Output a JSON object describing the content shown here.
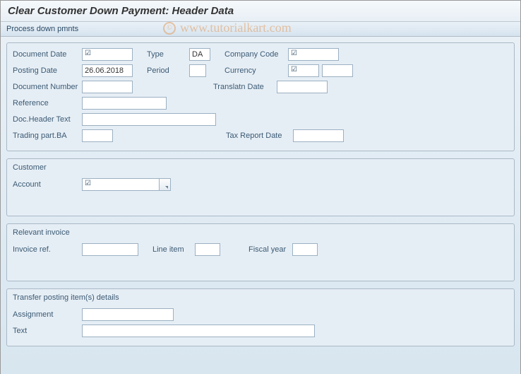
{
  "header": {
    "title": "Clear Customer Down Payment: Header Data"
  },
  "toolbar": {
    "process": "Process down pmnts"
  },
  "fields": {
    "document_date_label": "Document Date",
    "document_date_value": "",
    "posting_date_label": "Posting Date",
    "posting_date_value": "26.06.2018",
    "document_number_label": "Document Number",
    "document_number_value": "",
    "reference_label": "Reference",
    "reference_value": "",
    "doc_header_text_label": "Doc.Header Text",
    "doc_header_text_value": "",
    "trading_part_ba_label": "Trading part.BA",
    "trading_part_ba_value": "",
    "type_label": "Type",
    "type_value": "DA",
    "period_label": "Period",
    "period_value": "",
    "company_code_label": "Company Code",
    "company_code_value": "",
    "currency_label": "Currency",
    "currency_value": "",
    "translatn_date_label": "Translatn Date",
    "translatn_date_value": "",
    "tax_report_date_label": "Tax Report Date",
    "tax_report_date_value": ""
  },
  "customer": {
    "title": "Customer",
    "account_label": "Account",
    "account_value": ""
  },
  "invoice": {
    "title": "Relevant invoice",
    "invoice_ref_label": "Invoice ref.",
    "invoice_ref_value": "",
    "line_item_label": "Line item",
    "line_item_value": "",
    "fiscal_year_label": "Fiscal year",
    "fiscal_year_value": ""
  },
  "transfer": {
    "title": "Transfer posting item(s) details",
    "assignment_label": "Assignment",
    "assignment_value": "",
    "text_label": "Text",
    "text_value": ""
  },
  "watermark": {
    "copy": "©",
    "text": "www.tutorialkart.com"
  },
  "req_marker": "☑"
}
